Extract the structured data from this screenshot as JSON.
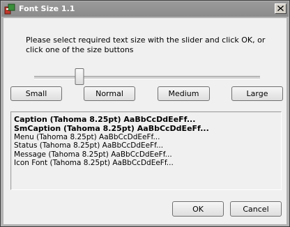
{
  "window": {
    "title": "Font Size 1.1"
  },
  "titlebar": {
    "app_icon": "app-icon",
    "close_icon": "close-icon"
  },
  "instructions": "Please select required text size with the slider and click OK, or click one of the size buttons",
  "slider": {
    "value": 0.2
  },
  "size_buttons": [
    {
      "label": "Small"
    },
    {
      "label": "Normal"
    },
    {
      "label": "Medium"
    },
    {
      "label": "Large"
    }
  ],
  "samples": [
    {
      "text": "Caption (Tahoma 8.25pt) AaBbCcDdEeFf...",
      "bold": true
    },
    {
      "text": "SmCaption (Tahoma 8.25pt) AaBbCcDdEeFf...",
      "bold": true
    },
    {
      "text": "Menu (Tahoma 8.25pt) AaBbCcDdEeFf...",
      "bold": false
    },
    {
      "text": "Status (Tahoma 8.25pt) AaBbCcDdEeFf...",
      "bold": false
    },
    {
      "text": "Message (Tahoma 8.25pt) AaBbCcDdEeFf...",
      "bold": false
    },
    {
      "text": "Icon Font (Tahoma 8.25pt) AaBbCcDdEeFf...",
      "bold": false
    }
  ],
  "actions": {
    "ok_label": "OK",
    "cancel_label": "Cancel"
  }
}
